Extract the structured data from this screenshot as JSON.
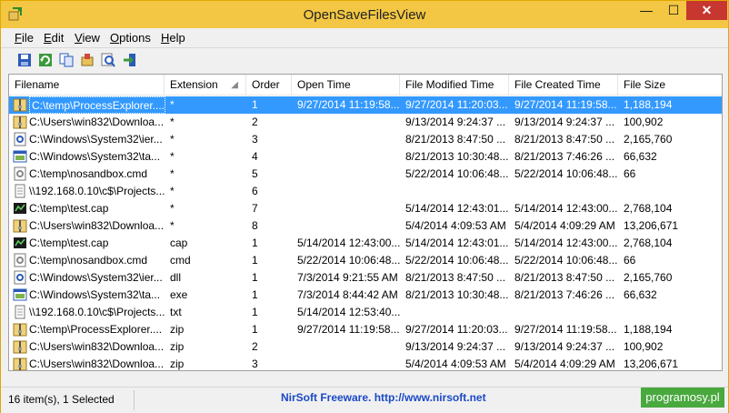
{
  "window": {
    "title": "OpenSaveFilesView"
  },
  "menu": [
    {
      "key": "F",
      "rest": "ile"
    },
    {
      "key": "E",
      "rest": "dit"
    },
    {
      "key": "V",
      "rest": "iew"
    },
    {
      "key": "O",
      "rest": "ptions"
    },
    {
      "key": "H",
      "rest": "elp"
    }
  ],
  "toolbar_icons": [
    "save-icon",
    "refresh-icon",
    "copy-icon",
    "properties-icon",
    "find-icon",
    "exit-icon"
  ],
  "columns": [
    "Filename",
    "Extension",
    "Order",
    "Open Time",
    "File Modified Time",
    "File Created Time",
    "File Size"
  ],
  "rows": [
    {
      "icon": "zip-icon",
      "name": "C:\\temp\\ProcessExplorer....",
      "ext": "*",
      "order": "1",
      "open": "9/27/2014 11:19:58...",
      "modified": "9/27/2014 11:20:03...",
      "created": "9/27/2014 11:19:58...",
      "size": "1,188,194",
      "selected": true
    },
    {
      "icon": "zip-icon",
      "name": "C:\\Users\\win832\\Downloa...",
      "ext": "*",
      "order": "2",
      "open": "",
      "modified": "9/13/2014 9:24:37 ...",
      "created": "9/13/2014 9:24:37 ...",
      "size": "100,902"
    },
    {
      "icon": "dll-icon",
      "name": "C:\\Windows\\System32\\ier...",
      "ext": "*",
      "order": "3",
      "open": "",
      "modified": "8/21/2013 8:47:50 ...",
      "created": "8/21/2013 8:47:50 ...",
      "size": "2,165,760"
    },
    {
      "icon": "exe-icon",
      "name": "C:\\Windows\\System32\\ta...",
      "ext": "*",
      "order": "4",
      "open": "",
      "modified": "8/21/2013 10:30:48...",
      "created": "8/21/2013 7:46:26 ...",
      "size": "66,632"
    },
    {
      "icon": "cmd-icon",
      "name": "C:\\temp\\nosandbox.cmd",
      "ext": "*",
      "order": "5",
      "open": "",
      "modified": "5/22/2014 10:06:48...",
      "created": "5/22/2014 10:06:48...",
      "size": "66"
    },
    {
      "icon": "txt-icon",
      "name": "\\\\192.168.0.10\\c$\\Projects...",
      "ext": "*",
      "order": "6",
      "open": "",
      "modified": "",
      "created": "",
      "size": ""
    },
    {
      "icon": "cap-icon",
      "name": "C:\\temp\\test.cap",
      "ext": "*",
      "order": "7",
      "open": "",
      "modified": "5/14/2014 12:43:01...",
      "created": "5/14/2014 12:43:00...",
      "size": "2,768,104"
    },
    {
      "icon": "zip-icon",
      "name": "C:\\Users\\win832\\Downloa...",
      "ext": "*",
      "order": "8",
      "open": "",
      "modified": "5/4/2014 4:09:53 AM",
      "created": "5/4/2014 4:09:29 AM",
      "size": "13,206,671"
    },
    {
      "icon": "cap-icon",
      "name": "C:\\temp\\test.cap",
      "ext": "cap",
      "order": "1",
      "open": "5/14/2014 12:43:00...",
      "modified": "5/14/2014 12:43:01...",
      "created": "5/14/2014 12:43:00...",
      "size": "2,768,104"
    },
    {
      "icon": "cmd-icon",
      "name": "C:\\temp\\nosandbox.cmd",
      "ext": "cmd",
      "order": "1",
      "open": "5/22/2014 10:06:48...",
      "modified": "5/22/2014 10:06:48...",
      "created": "5/22/2014 10:06:48...",
      "size": "66"
    },
    {
      "icon": "dll-icon",
      "name": "C:\\Windows\\System32\\ier...",
      "ext": "dll",
      "order": "1",
      "open": "7/3/2014 9:21:55 AM",
      "modified": "8/21/2013 8:47:50 ...",
      "created": "8/21/2013 8:47:50 ...",
      "size": "2,165,760"
    },
    {
      "icon": "exe-icon",
      "name": "C:\\Windows\\System32\\ta...",
      "ext": "exe",
      "order": "1",
      "open": "7/3/2014 8:44:42 AM",
      "modified": "8/21/2013 10:30:48...",
      "created": "8/21/2013 7:46:26 ...",
      "size": "66,632"
    },
    {
      "icon": "txt-icon",
      "name": "\\\\192.168.0.10\\c$\\Projects...",
      "ext": "txt",
      "order": "1",
      "open": "5/14/2014 12:53:40...",
      "modified": "",
      "created": "",
      "size": ""
    },
    {
      "icon": "zip-icon",
      "name": "C:\\temp\\ProcessExplorer....",
      "ext": "zip",
      "order": "1",
      "open": "9/27/2014 11:19:58...",
      "modified": "9/27/2014 11:20:03...",
      "created": "9/27/2014 11:19:58...",
      "size": "1,188,194"
    },
    {
      "icon": "zip-icon",
      "name": "C:\\Users\\win832\\Downloa...",
      "ext": "zip",
      "order": "2",
      "open": "",
      "modified": "9/13/2014 9:24:37 ...",
      "created": "9/13/2014 9:24:37 ...",
      "size": "100,902"
    },
    {
      "icon": "zip-icon",
      "name": "C:\\Users\\win832\\Downloa...",
      "ext": "zip",
      "order": "3",
      "open": "",
      "modified": "5/4/2014 4:09:53 AM",
      "created": "5/4/2014 4:09:29 AM",
      "size": "13,206,671"
    }
  ],
  "status": {
    "count": "16 item(s), 1 Selected",
    "credit": "NirSoft Freeware.  http://www.nirsoft.net"
  },
  "watermark": "programosy.pl",
  "colors": {
    "titlebar": "#f3c743",
    "selection": "#3399ff",
    "close": "#c7372f",
    "credit": "#1a49c7"
  }
}
